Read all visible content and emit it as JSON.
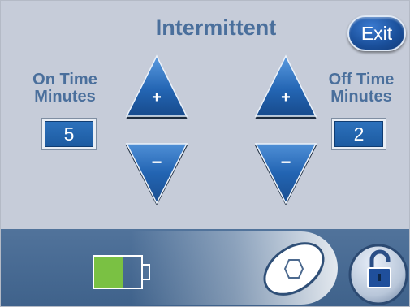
{
  "screen": {
    "title": "Intermittent",
    "exit_label": "Exit"
  },
  "on_time": {
    "label_line1": "On Time",
    "label_line2": "Minutes",
    "value": "5",
    "increase_symbol": "+",
    "decrease_symbol": "−"
  },
  "off_time": {
    "label_line1": "Off Time",
    "label_line2": "Minutes",
    "value": "2",
    "increase_symbol": "+",
    "decrease_symbol": "−"
  },
  "status_bar": {
    "battery_icon": "battery-icon",
    "battery_color": "#7ac143",
    "slider_icon": "slide-to-unlock-knob-icon",
    "lock_icon": "padlock-unlocked-icon"
  },
  "colors": {
    "background": "#c6ccd9",
    "accent_text": "#4a6f9c",
    "button_blue": "#1a4f9a",
    "bottom_bar": "#4a6c94"
  }
}
